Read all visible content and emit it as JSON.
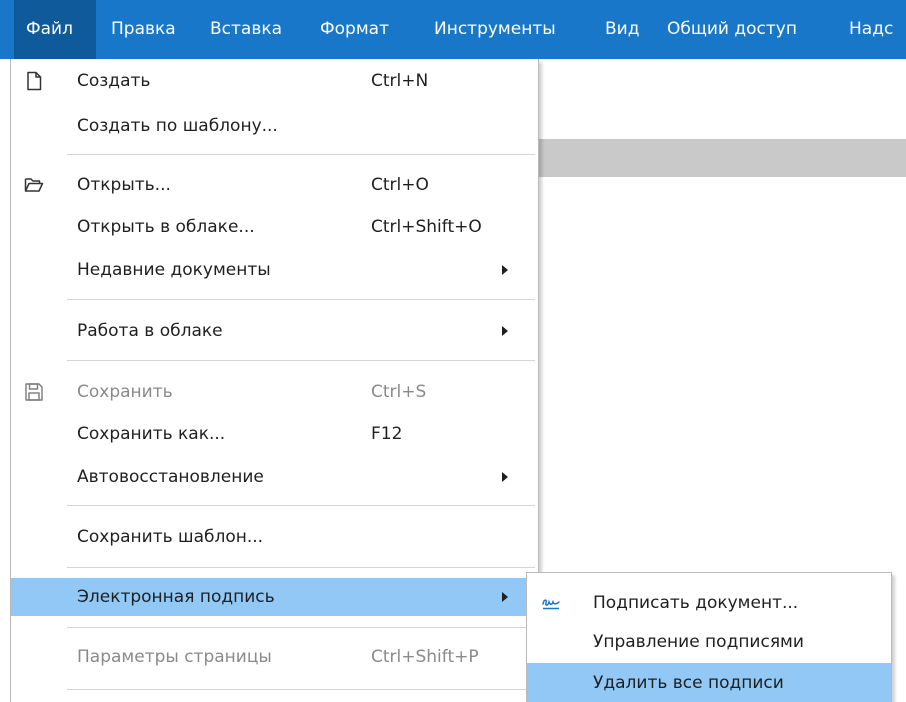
{
  "menubar": {
    "items": [
      {
        "label": "Файл"
      },
      {
        "label": "Правка"
      },
      {
        "label": "Вставка"
      },
      {
        "label": "Формат"
      },
      {
        "label": "Инструменты"
      },
      {
        "label": "Вид"
      },
      {
        "label": "Общий доступ"
      },
      {
        "label": "Надс"
      }
    ]
  },
  "file_menu": {
    "create": {
      "label": "Создать",
      "shortcut": "Ctrl+N",
      "icon": "new-document-icon"
    },
    "create_template": {
      "label": "Создать по шаблону..."
    },
    "open": {
      "label": "Открыть...",
      "shortcut": "Ctrl+O",
      "icon": "open-folder-icon"
    },
    "open_cloud": {
      "label": "Открыть в облаке...",
      "shortcut": "Ctrl+Shift+O"
    },
    "recent": {
      "label": "Недавние документы"
    },
    "cloud_work": {
      "label": "Работа в облаке"
    },
    "save": {
      "label": "Сохранить",
      "shortcut": "Ctrl+S",
      "icon": "save-icon"
    },
    "save_as": {
      "label": "Сохранить как...",
      "shortcut": "F12"
    },
    "autorecovery": {
      "label": "Автовосстановление"
    },
    "save_template": {
      "label": "Сохранить шаблон..."
    },
    "e_signature": {
      "label": "Электронная подпись"
    },
    "page_setup": {
      "label": "Параметры страницы",
      "shortcut": "Ctrl+Shift+P"
    }
  },
  "signature_submenu": {
    "sign": {
      "label": "Подписать документ...",
      "icon": "signature-icon"
    },
    "manage": {
      "label": "Управление подписями"
    },
    "remove_all": {
      "label": "Удалить все подписи"
    }
  },
  "colors": {
    "menubar_bg": "#1877c9",
    "menubar_active": "#0f5a9b",
    "highlight": "#91c8f5",
    "disabled_text": "#8a8a8a"
  }
}
